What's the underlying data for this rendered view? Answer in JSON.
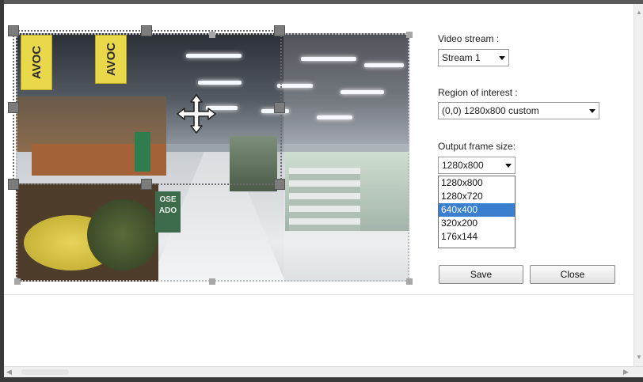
{
  "video_stream": {
    "label": "Video stream :",
    "selected": "Stream 1"
  },
  "region_of_interest": {
    "label": "Region of interest :",
    "selected": "(0,0) 1280x800 custom"
  },
  "output_frame_size": {
    "label": "Output frame size:",
    "selected": "1280x800",
    "options": [
      "1280x800",
      "1280x720",
      "640x400",
      "320x200",
      "176x144"
    ],
    "highlighted": "640x400"
  },
  "buttons": {
    "save": "Save",
    "close": "Close"
  },
  "preview": {
    "sign_text_1": "AVOC",
    "sign_text_2": "AVOC",
    "green_sign": "OSE\nADO"
  },
  "icons": {
    "move": "move-cross-icon",
    "dropdown": "chevron-down-icon",
    "scroll_up": "scroll-up-arrow-icon",
    "scroll_down": "scroll-down-arrow-icon",
    "scroll_left": "scroll-left-arrow-icon",
    "scroll_right": "scroll-right-arrow-icon"
  },
  "colors": {
    "selection_highlight": "#3a7fcf",
    "roi_handle": "#7c7c7c"
  }
}
